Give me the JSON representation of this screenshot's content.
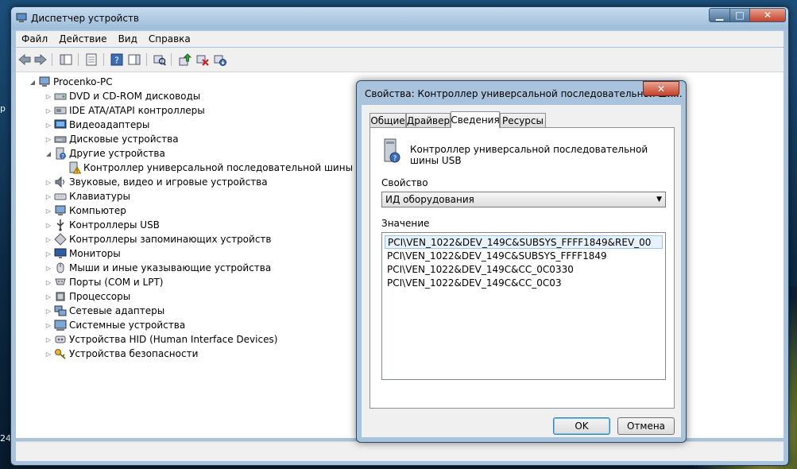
{
  "window": {
    "title": "Диспетчер устройств"
  },
  "menu": [
    "Файл",
    "Действие",
    "Вид",
    "Справка"
  ],
  "desktop_fragments": {
    "left_mid": "p",
    "left_bottom": "24"
  },
  "tree": {
    "root": "Procenko-PC",
    "items": [
      {
        "label": "DVD и CD-ROM дисководы",
        "icon": "dvd-drive-icon",
        "expanded": false
      },
      {
        "label": "IDE ATA/ATAPI контроллеры",
        "icon": "ide-controller-icon",
        "expanded": false
      },
      {
        "label": "Видеоадаптеры",
        "icon": "display-adapter-icon",
        "expanded": false
      },
      {
        "label": "Дисковые устройства",
        "icon": "disk-drive-icon",
        "expanded": false
      },
      {
        "label": "Другие устройства",
        "icon": "unknown-device-icon",
        "expanded": true
      },
      {
        "label": "Контроллер универсальной последовательной шины USB",
        "icon": "warning-device-icon",
        "child": true
      },
      {
        "label": "Звуковые, видео и игровые устройства",
        "icon": "speaker-icon",
        "expanded": false
      },
      {
        "label": "Клавиатуры",
        "icon": "keyboard-icon",
        "expanded": false
      },
      {
        "label": "Компьютер",
        "icon": "computer-icon",
        "expanded": false
      },
      {
        "label": "Контроллеры USB",
        "icon": "usb-icon",
        "expanded": false
      },
      {
        "label": "Контроллеры запоминающих устройств",
        "icon": "storage-controller-icon",
        "expanded": false
      },
      {
        "label": "Мониторы",
        "icon": "monitor-icon",
        "expanded": false
      },
      {
        "label": "Мыши и иные указывающие устройства",
        "icon": "mouse-icon",
        "expanded": false
      },
      {
        "label": "Порты (COM и LPT)",
        "icon": "port-icon",
        "expanded": false
      },
      {
        "label": "Процессоры",
        "icon": "processor-icon",
        "expanded": false
      },
      {
        "label": "Сетевые адаптеры",
        "icon": "network-adapter-icon",
        "expanded": false
      },
      {
        "label": "Системные устройства",
        "icon": "system-device-icon",
        "expanded": false
      },
      {
        "label": "Устройства HID (Human Interface Devices)",
        "icon": "hid-icon",
        "expanded": false
      },
      {
        "label": "Устройства безопасности",
        "icon": "security-device-icon",
        "expanded": false
      }
    ]
  },
  "dialog": {
    "title": "Свойства: Контроллер универсальной последовательной ши...",
    "close_glyph": "✕",
    "tabs": [
      "Общие",
      "Драйвер",
      "Сведения",
      "Ресурсы"
    ],
    "active_tab": "Сведения",
    "device_name": "Контроллер универсальной последовательной шины USB",
    "property_label": "Свойство",
    "property_value": "ИД оборудования",
    "value_label": "Значение",
    "values": [
      "PCI\\VEN_1022&DEV_149C&SUBSYS_FFFF1849&REV_00",
      "PCI\\VEN_1022&DEV_149C&SUBSYS_FFFF1849",
      "PCI\\VEN_1022&DEV_149C&CC_0C0330",
      "PCI\\VEN_1022&DEV_149C&CC_0C03"
    ],
    "ok_label": "OK",
    "cancel_label": "Отмена"
  }
}
